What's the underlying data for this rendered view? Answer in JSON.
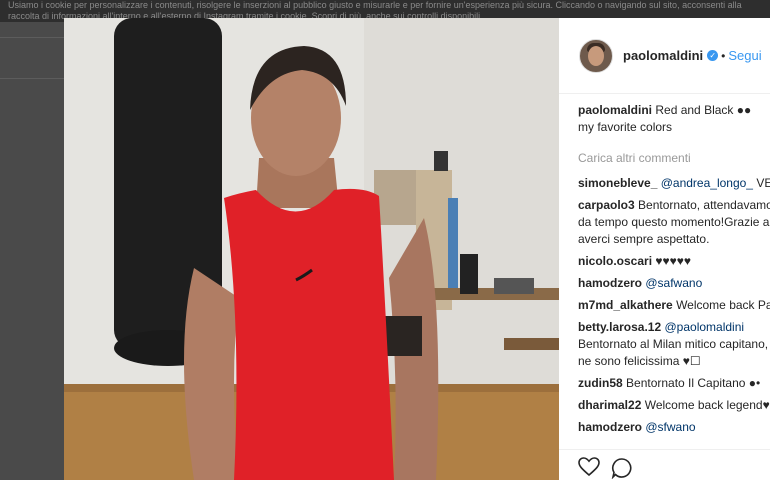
{
  "cookie_notice": "Usiamo i cookie per personalizzare i contenuti, risolgere le inserzioni al pubblico giusto e misurarle e per fornire un'esperienza più sicura. Cliccando o navigando sul sito, acconsenti alla raccolta di informazioni all'interno e all'esterno di Instagram tramite i cookie. Scopri di più, anche sui controlli disponibili",
  "post": {
    "author": "paolomaldini",
    "follow_label": "Segui",
    "separator": "•",
    "caption_user": "paolomaldini",
    "caption_text": "Red and Black ●● my favorite colors",
    "load_more": "Carica altri commenti"
  },
  "comments": [
    {
      "user": "simonebleve_",
      "mention": "@andrea_longo_",
      "text": "VEGGO"
    },
    {
      "user": "carpaolo3",
      "mention": "",
      "text": "Bentornato, attendavamo da tempo questo momento!Grazie ad averci sempre aspettato."
    },
    {
      "user": "nicolo.oscari",
      "mention": "",
      "text": "♥♥♥♥♥"
    },
    {
      "user": "hamodzero",
      "mention": "@safwano",
      "text": ""
    },
    {
      "user": "m7md_alkathere",
      "mention": "",
      "text": "Welcome back Paolo"
    },
    {
      "user": "betty.larosa.12",
      "mention": "@paolomaldini",
      "text": "Bentornato al Milan mitico capitano, ne sono felicissima ♥☐"
    },
    {
      "user": "zudin58",
      "mention": "",
      "text": "Bentornato Il Capitano ●•"
    },
    {
      "user": "dharimal22",
      "mention": "",
      "text": "Welcome back legend♥☐"
    },
    {
      "user": "hamodzero",
      "mention": "@sfwano",
      "text": ""
    }
  ],
  "colors": {
    "instagram_blue": "#3897f0",
    "mention": "#003569",
    "tank_top": "#e02128"
  }
}
